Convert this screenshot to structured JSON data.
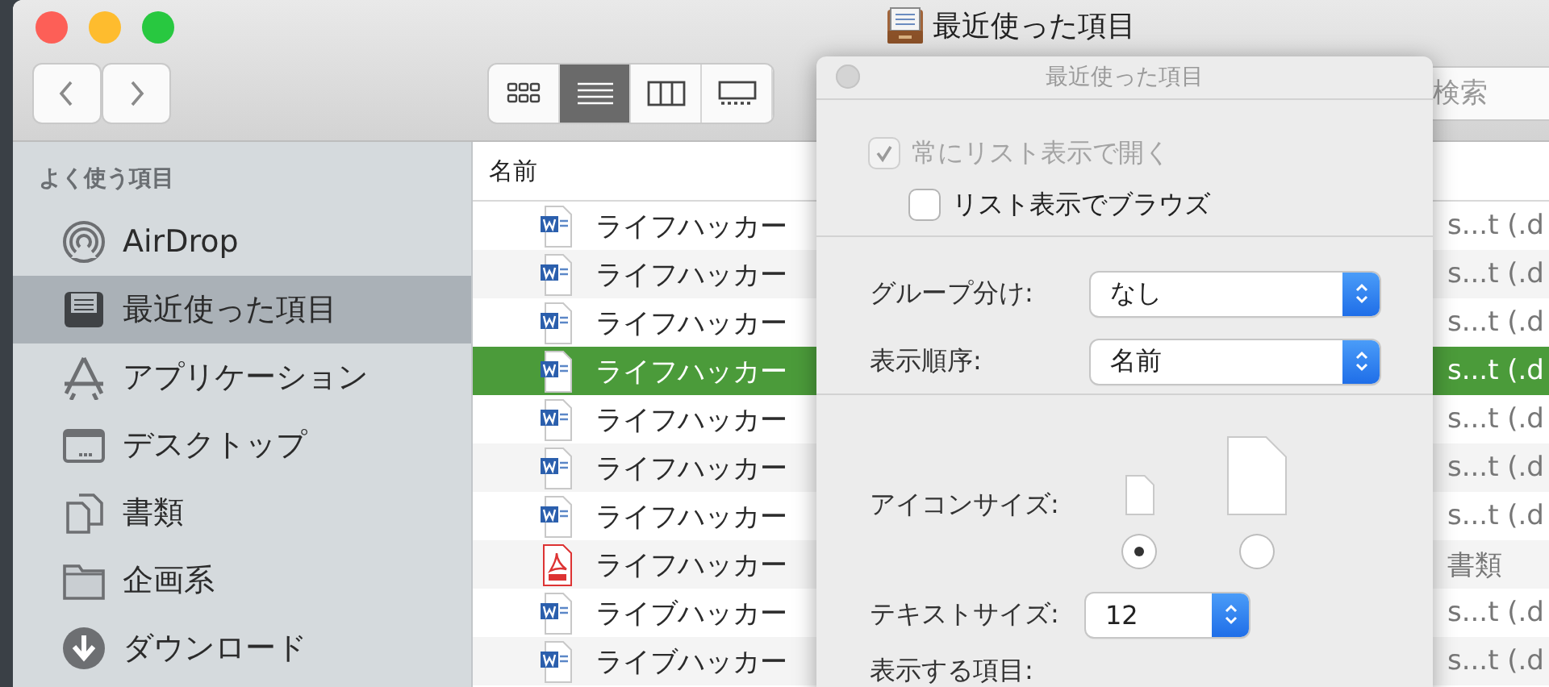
{
  "window": {
    "title": "最近使った項目"
  },
  "toolbar": {
    "nav": [
      {
        "kind": "back"
      },
      {
        "kind": "forward"
      }
    ],
    "view_buttons": [
      {
        "kind": "icons",
        "selected": false
      },
      {
        "kind": "list",
        "selected": true
      },
      {
        "kind": "columns",
        "selected": false
      },
      {
        "kind": "gallery",
        "selected": false
      }
    ],
    "search": {
      "placeholder": "検索"
    }
  },
  "sidebar": {
    "heading": "よく使う項目",
    "items": [
      {
        "label": "AirDrop",
        "kind": "airdrop",
        "selected": false
      },
      {
        "label": "最近使った項目",
        "kind": "recents",
        "selected": true
      },
      {
        "label": "アプリケーション",
        "kind": "apps",
        "selected": false
      },
      {
        "label": "デスクトップ",
        "kind": "desktop",
        "selected": false
      },
      {
        "label": "書類",
        "kind": "documents",
        "selected": false
      },
      {
        "label": "企画系",
        "kind": "folder",
        "selected": false
      },
      {
        "label": "ダウンロード",
        "kind": "downloads",
        "selected": false
      }
    ]
  },
  "file_list": {
    "columns": [
      "名前"
    ],
    "rows": [
      {
        "name": "ライフハッカー",
        "kind": "word",
        "column_2": "s...t (.d",
        "selected": false
      },
      {
        "name": "ライフハッカー",
        "kind": "word",
        "column_2": "s...t (.d",
        "selected": false
      },
      {
        "name": "ライフハッカー",
        "kind": "word",
        "column_2": "s...t (.d",
        "selected": false
      },
      {
        "name": "ライフハッカー",
        "kind": "word",
        "column_2": "s...t (.d",
        "selected": true
      },
      {
        "name": "ライフハッカー",
        "kind": "word",
        "column_2": "s...t (.d",
        "selected": false
      },
      {
        "name": "ライフハッカー",
        "kind": "word",
        "column_2": "s...t (.d",
        "selected": false
      },
      {
        "name": "ライフハッカー",
        "kind": "word",
        "column_2": "s...t (.d",
        "selected": false
      },
      {
        "name": "ライフハッカー",
        "kind": "pdf",
        "column_2": "書類",
        "selected": false
      },
      {
        "name": "ライブハッカー",
        "kind": "word",
        "column_2": "s...t (.d",
        "selected": false
      },
      {
        "name": "ライブハッカー",
        "kind": "word",
        "column_2": "s...t (.d",
        "selected": false
      }
    ]
  },
  "view_options": {
    "title": "最近使った項目",
    "checkboxes": [
      {
        "label": "常にリスト表示で開く",
        "checked": true,
        "disabled": true
      },
      {
        "label": "リスト表示でブラウズ",
        "checked": false,
        "disabled": false
      }
    ],
    "selects": [
      {
        "label": "グループ分け:",
        "value": "なし"
      },
      {
        "label": "表示順序:",
        "value": "名前"
      }
    ],
    "icon_size": {
      "label": "アイコンサイズ:",
      "options": [
        {
          "kind": "small",
          "selected": true
        },
        {
          "kind": "large",
          "selected": false
        }
      ]
    },
    "text_size": {
      "label": "テキストサイズ:",
      "value": "12"
    },
    "shown_items_label": "表示する項目:"
  }
}
